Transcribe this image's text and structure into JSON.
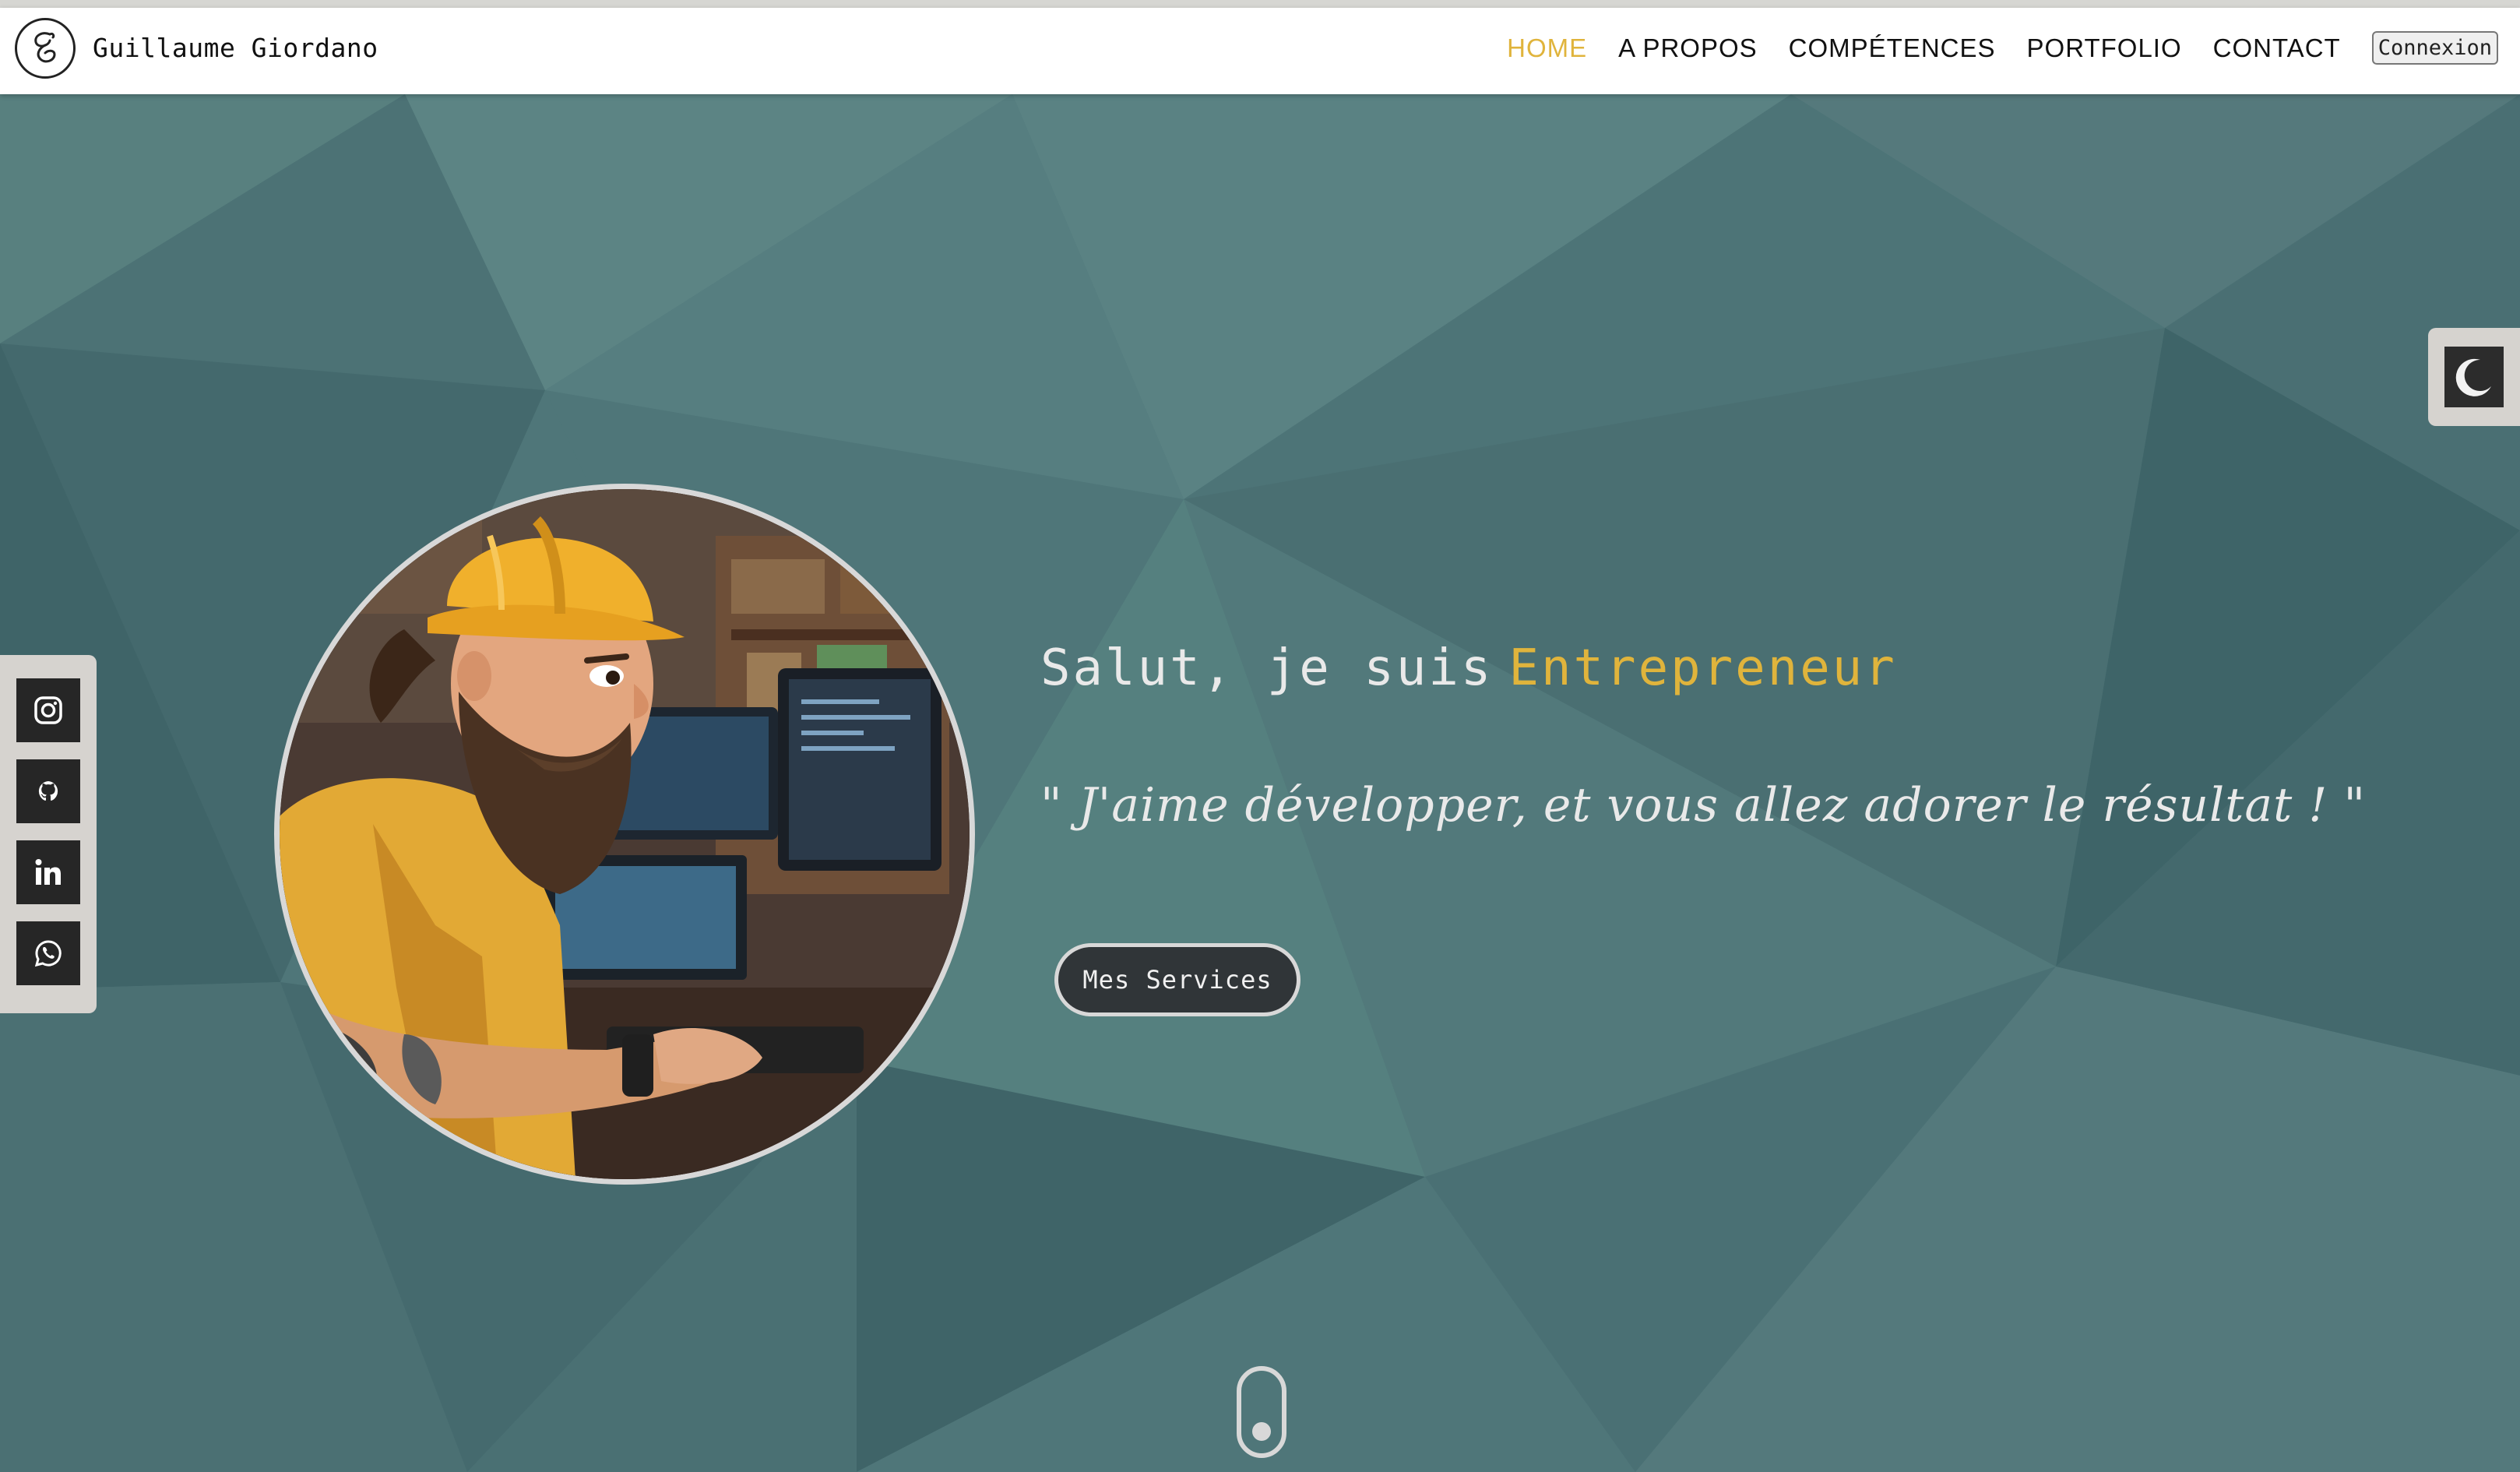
{
  "header": {
    "site_name": "Guillaume Giordano",
    "logo_icon": "g-monogram-icon",
    "nav": [
      {
        "label": "HOME",
        "active": true
      },
      {
        "label": "A PROPOS",
        "active": false
      },
      {
        "label": "COMPÉTENCES",
        "active": false
      },
      {
        "label": "PORTFOLIO",
        "active": false
      },
      {
        "label": "CONTACT",
        "active": false
      }
    ],
    "login_label": "Connexion"
  },
  "hero": {
    "greeting": "Salut, je suis",
    "role": "Entrepreneur",
    "quote": "\" J'aime développer, et vous allez adorer le résultat ! \"",
    "cta_label": "Mes Services",
    "avatar_alt": "bearded-developer-with-hard-hat-illustration"
  },
  "social": [
    {
      "name": "instagram",
      "icon": "instagram-icon"
    },
    {
      "name": "github",
      "icon": "github-icon"
    },
    {
      "name": "linkedin",
      "icon": "linkedin-icon"
    },
    {
      "name": "whatsapp",
      "icon": "whatsapp-icon"
    }
  ],
  "theme_toggle": {
    "icon": "moon-icon"
  },
  "colors": {
    "accent": "#e0b43c",
    "hero_bg": "#4f7679",
    "nav_bg": "#ffffff",
    "button_bg": "#303538",
    "side_panel": "#d6d3cf"
  }
}
